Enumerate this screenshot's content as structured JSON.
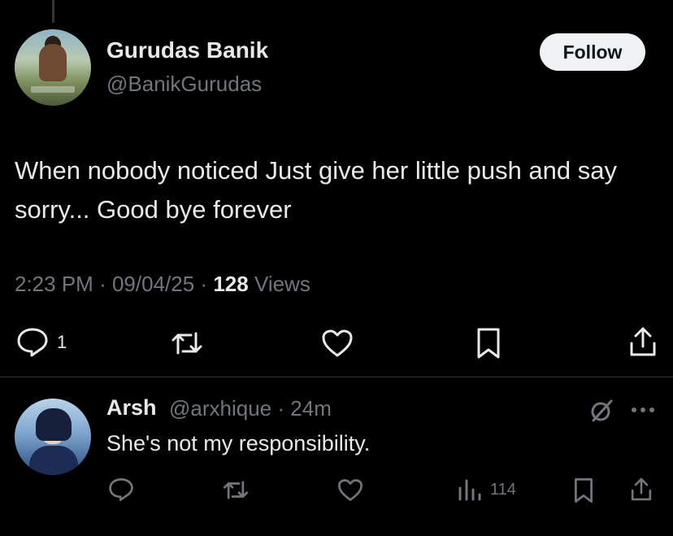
{
  "author": {
    "display_name": "Gurudas Banik",
    "handle": "@BanikGurudas",
    "follow_label": "Follow"
  },
  "tweet": {
    "text": "When nobody noticed Just give her little push and say sorry... Good bye forever",
    "time": "2:23 PM",
    "sep1": "·",
    "date": "09/04/25",
    "sep2": "·",
    "views_count": "128",
    "views_label": "Views",
    "reply_count": "1"
  },
  "reply": {
    "name": "Arsh",
    "handle": "@arxhique",
    "sep": "·",
    "age": "24m",
    "text": "She's not my responsibility.",
    "views": "114"
  },
  "icons": {
    "reply": "reply-icon",
    "retweet": "retweet-icon",
    "like": "heart-icon",
    "bookmark": "bookmark-icon",
    "share": "share-icon",
    "views": "analytics-icon",
    "grok": "grok-icon",
    "more": "more-icon"
  },
  "colors": {
    "background": "#000000",
    "text": "#e7e9ea",
    "muted": "#71767b",
    "follow_bg": "#eff3f4"
  }
}
